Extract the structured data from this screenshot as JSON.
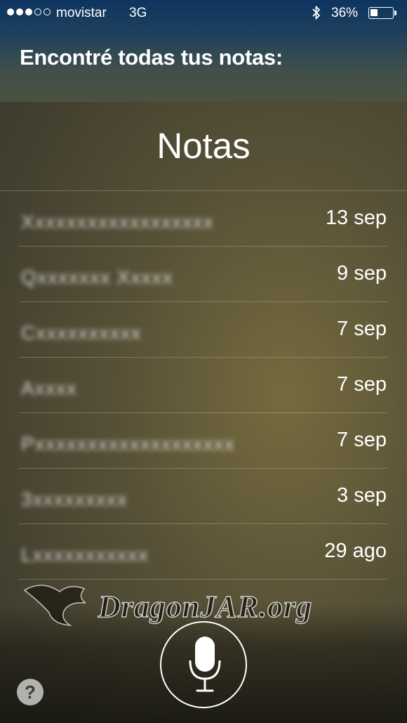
{
  "status_bar": {
    "signal_bars_filled": 3,
    "signal_bars_total": 5,
    "carrier": "movistar",
    "network": "3G",
    "bluetooth_icon": "bluetooth-icon",
    "battery_percent_label": "36%",
    "battery_level": 0.36
  },
  "siri": {
    "response": "Encontré todas tus notas:"
  },
  "notes_card": {
    "title": "Notas",
    "items": [
      {
        "title": "Xxxxxxxxxxxxxxxxxx",
        "date": "13 sep"
      },
      {
        "title": "Qxxxxxxx Xxxxx",
        "date": "9 sep"
      },
      {
        "title": "Cxxxxxxxxxx",
        "date": "7 sep"
      },
      {
        "title": "Axxxx",
        "date": "7 sep"
      },
      {
        "title": "Pxxxxxxxxxxxxxxxxxxx",
        "date": "7 sep"
      },
      {
        "title": "3xxxxxxxxx",
        "date": "3 sep"
      },
      {
        "title": "Lxxxxxxxxxxx",
        "date": "29 ago"
      }
    ]
  },
  "watermark": "DragonJAR.org",
  "controls": {
    "mic_icon": "microphone-icon",
    "help_label": "?"
  }
}
